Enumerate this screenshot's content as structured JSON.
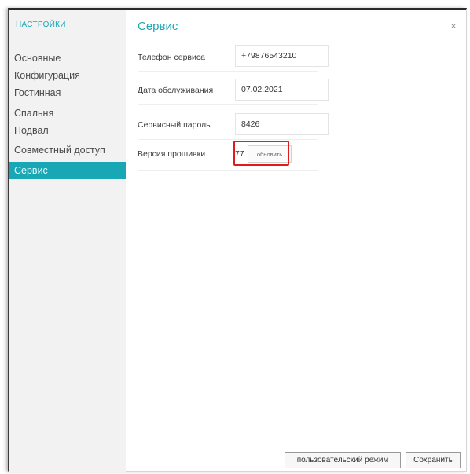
{
  "sidebar": {
    "header": "настройки",
    "items": [
      {
        "label": "Основные"
      },
      {
        "label": "Конфигурация"
      },
      {
        "label": "Гостинная"
      },
      {
        "label": "Спальня"
      },
      {
        "label": "Подвал"
      },
      {
        "label": "Совместный доступ"
      },
      {
        "label": "Сервис"
      }
    ],
    "active_item": "Сервис"
  },
  "main": {
    "title": "Сервис",
    "close_icon": "×",
    "fields": {
      "phone": {
        "label": "Телефон сервиса",
        "value": "+79876543210"
      },
      "service_date": {
        "label": "Дата обслуживания",
        "value": "07.02.2021"
      },
      "password": {
        "label": "Сервисный пароль",
        "value": "8426"
      },
      "firmware": {
        "label": "Версия прошивки",
        "value": "77",
        "button_label": "обновить"
      }
    }
  },
  "footer": {
    "user_mode_label": "пользовательский режим",
    "save_label": "Сохранить"
  },
  "colors": {
    "accent": "#19a6b5",
    "highlight": "#e11b1b",
    "sidebar_bg": "#f2f2f2"
  }
}
